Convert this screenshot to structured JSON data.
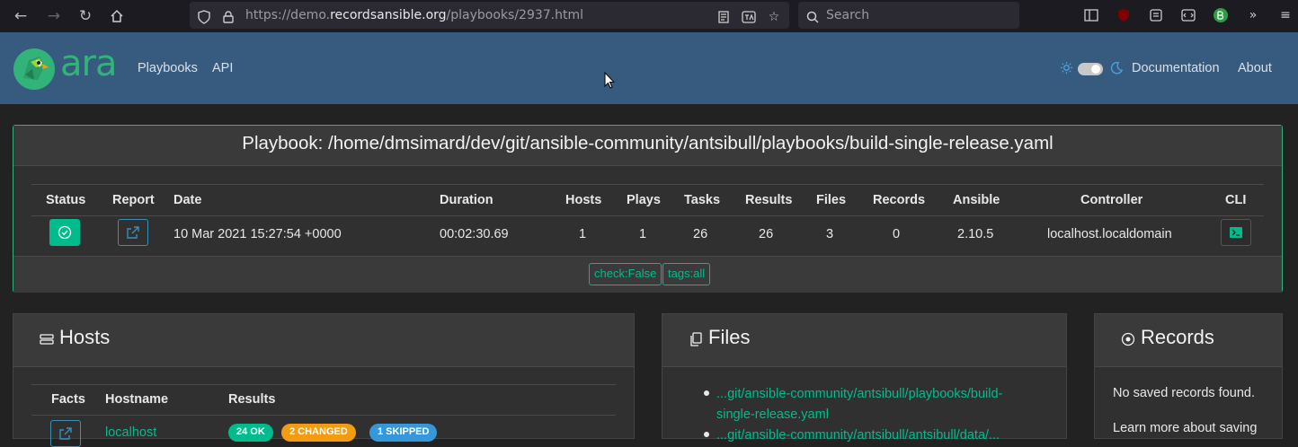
{
  "browser": {
    "url_prefix": "https://demo.",
    "url_host": "recordsansible.org",
    "url_path": "/playbooks/2937.html",
    "search_placeholder": "Search"
  },
  "navbar": {
    "logo_text": "ara",
    "links": [
      "Playbooks",
      "API"
    ],
    "right_links": [
      "Documentation",
      "About"
    ]
  },
  "playbook": {
    "title": "Playbook: /home/dmsimard/dev/git/ansible-community/antsibull/playbooks/build-single-release.yaml",
    "headers": [
      "Status",
      "Report",
      "Date",
      "Duration",
      "Hosts",
      "Plays",
      "Tasks",
      "Results",
      "Files",
      "Records",
      "Ansible",
      "Controller",
      "CLI"
    ],
    "row": {
      "date": "10 Mar 2021 15:27:54 +0000",
      "duration": "00:02:30.69",
      "hosts": "1",
      "plays": "1",
      "tasks": "26",
      "results": "26",
      "files": "3",
      "records": "0",
      "ansible": "2.10.5",
      "controller": "localhost.localdomain"
    },
    "tags": [
      "check:False",
      "tags:all"
    ]
  },
  "hosts": {
    "title": "Hosts",
    "headers": [
      "Facts",
      "Hostname",
      "Results"
    ],
    "badges": [
      {
        "label": "24 OK",
        "color": "#00bc8c"
      },
      {
        "label": "2 CHANGED",
        "color": "#f39c12"
      },
      {
        "label": "1 SKIPPED",
        "color": "#3498db"
      }
    ],
    "row_hostname": "localhost"
  },
  "files": {
    "title": "Files",
    "items": [
      "...git/ansible-community/antsibull/playbooks/build-",
      "single-release.yaml",
      "...git/ansible-community/antsibull/antsibull/data/..."
    ]
  },
  "records": {
    "title": "Records",
    "empty_text": "No saved records found.",
    "learn_text": "Learn more about saving"
  },
  "colors": {
    "navbar": "#375a7f",
    "accent": "#00bc8c",
    "background": "#222222"
  }
}
